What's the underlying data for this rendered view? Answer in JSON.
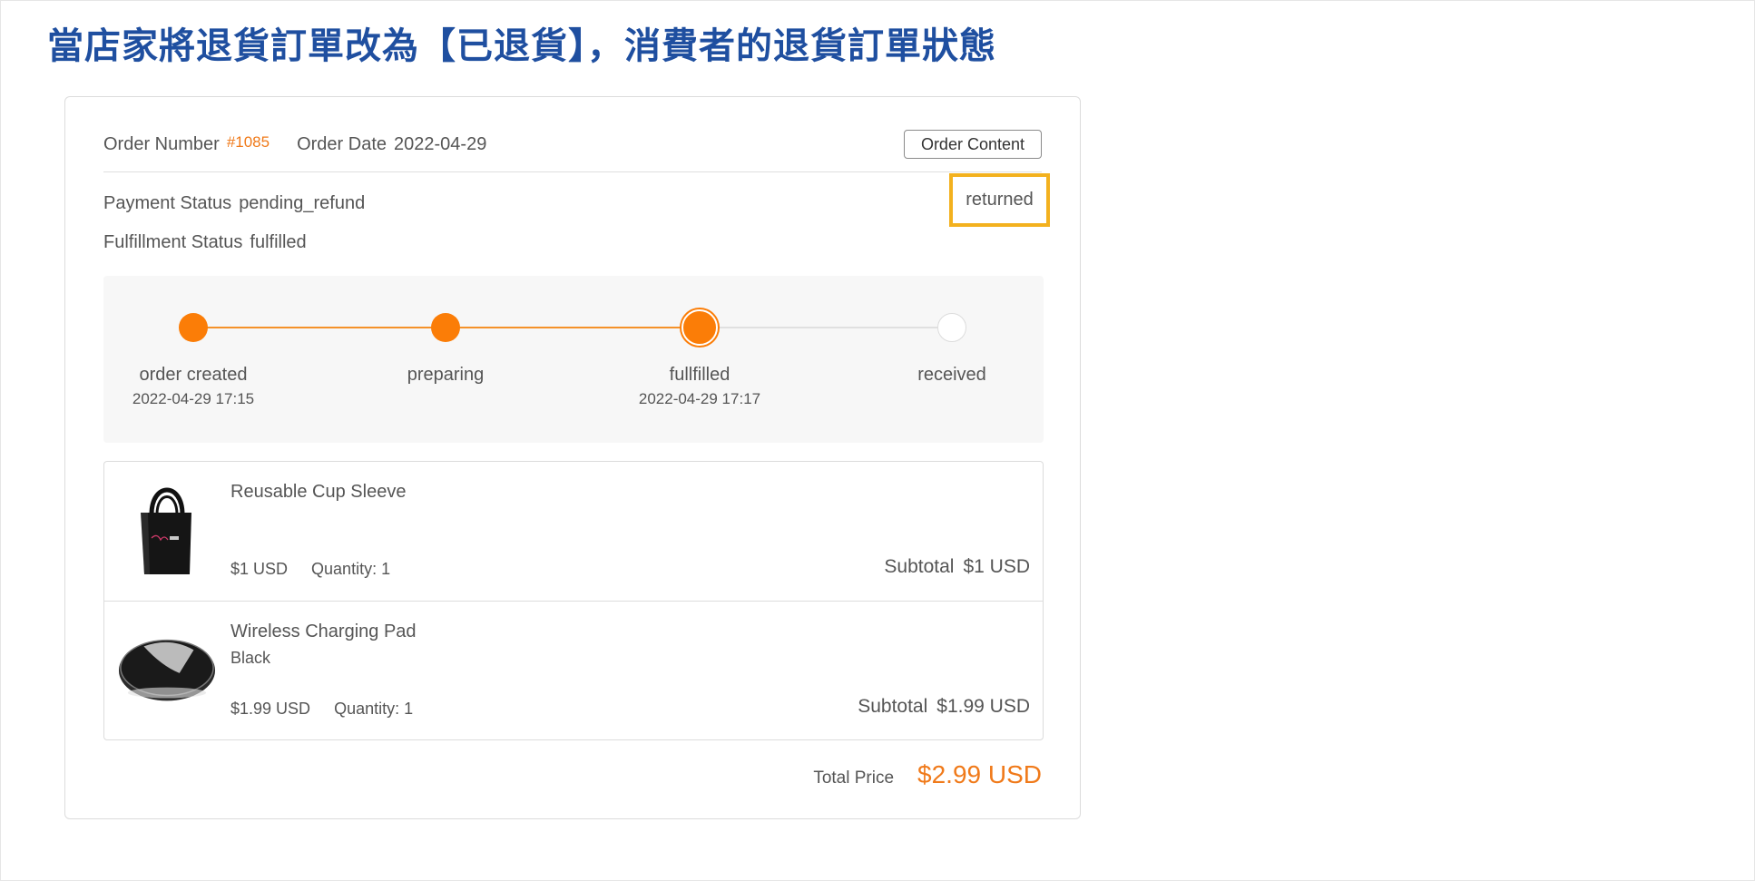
{
  "heading": "當店家將退貨訂單改為【已退貨】，消費者的退貨訂單狀態",
  "order": {
    "number_label": "Order Number",
    "number": "#1085",
    "date_label": "Order Date",
    "date": "2022-04-29",
    "content_button": "Order Content"
  },
  "status": {
    "payment_label": "Payment Status",
    "payment_value": "pending_refund",
    "fulfillment_label": "Fulfillment Status",
    "fulfillment_value": "fulfilled",
    "order_state": "returned",
    "highlight_color": "#f3b11e"
  },
  "progress": {
    "accent_color": "#fb7d07",
    "steps": [
      {
        "label": "order created",
        "time": "2022-04-29 17:15",
        "state": "done"
      },
      {
        "label": "preparing",
        "time": "",
        "state": "done"
      },
      {
        "label": "fullfilled",
        "time": "2022-04-29 17:17",
        "state": "current"
      },
      {
        "label": "received",
        "time": "",
        "state": "pending"
      }
    ]
  },
  "items": [
    {
      "name": "Reusable Cup Sleeve",
      "variant": "",
      "price": "$1 USD",
      "quantity": "Quantity: 1",
      "subtotal_label": "Subtotal",
      "subtotal": "$1 USD",
      "image": "black-tote-bag"
    },
    {
      "name": "Wireless Charging Pad",
      "variant": "Black",
      "price": "$1.99 USD",
      "quantity": "Quantity: 1",
      "subtotal_label": "Subtotal",
      "subtotal": "$1.99 USD",
      "image": "black-charging-pad"
    }
  ],
  "total": {
    "label": "Total Price",
    "value": "$2.99 USD"
  }
}
